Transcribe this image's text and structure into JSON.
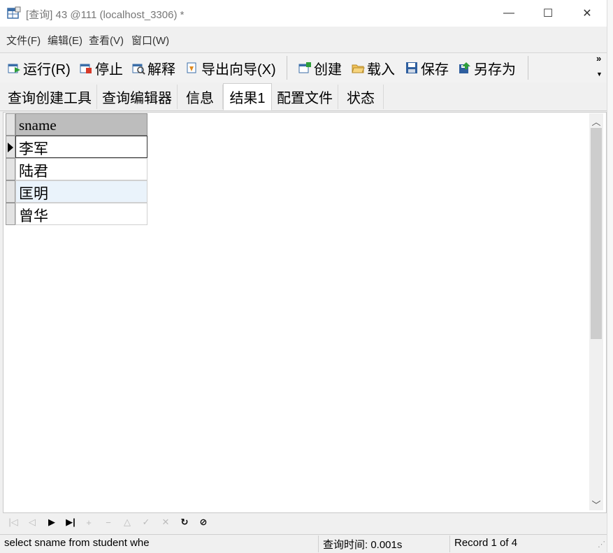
{
  "window": {
    "title": "[查询] 43 @111 (localhost_3306) *",
    "minimize_glyph": "—",
    "maximize_glyph": "☐",
    "close_glyph": "✕"
  },
  "menu": [
    "文件(F)",
    "编辑(E)",
    "查看(V)",
    "窗口(W)"
  ],
  "toolbar": {
    "run": "运行(R)",
    "stop": "停止",
    "explain": "解释",
    "export_wizard": "导出向导(X)",
    "create": "创建",
    "load": "载入",
    "save": "保存",
    "save_as": "另存为",
    "overflow": "»"
  },
  "tabs": [
    {
      "label": "查询创建工具",
      "active": false
    },
    {
      "label": "查询编辑器",
      "active": false
    },
    {
      "label": "信息",
      "active": false
    },
    {
      "label": "结果1",
      "active": true
    },
    {
      "label": "配置文件",
      "active": false
    },
    {
      "label": "状态",
      "active": false
    }
  ],
  "grid": {
    "columns": [
      "sname"
    ],
    "rows": [
      [
        "李军"
      ],
      [
        "陆君"
      ],
      [
        "匡明"
      ],
      [
        "曾华"
      ]
    ],
    "selected_row": 0
  },
  "navigator": {
    "first": "|◁",
    "prev": "◁",
    "next": "▶",
    "last": "▶|",
    "insert": "+",
    "delete": "−",
    "edit": "△",
    "post": "✓",
    "cancel": "✕",
    "refresh": "↻",
    "stop": "⊘"
  },
  "status": {
    "sql": "select sname from student whe",
    "query_time": "查询时间: 0.001s",
    "record": "Record 1 of 4"
  },
  "colors": {
    "selected_row_bg": "#eaf3fb",
    "header_bg": "#bdbdbd"
  }
}
